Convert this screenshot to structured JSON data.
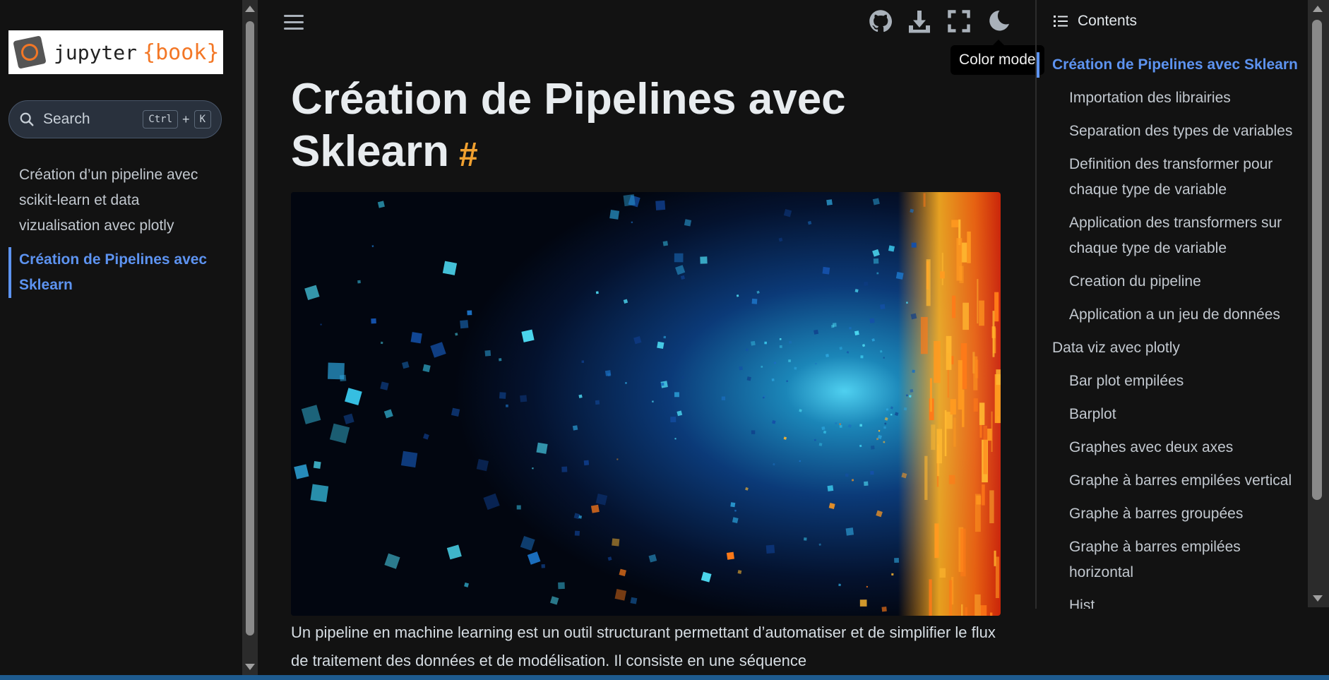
{
  "sidebar": {
    "logo": {
      "word1": "jupyter",
      "word2": "{book}"
    },
    "search": {
      "placeholder": "Search",
      "shortcut_ctrl": "Ctrl",
      "shortcut_plus": "+",
      "shortcut_key": "K"
    },
    "items": [
      {
        "label": "Création d’un pipeline avec scikit-learn et data vizualisation avec plotly",
        "active": false
      },
      {
        "label": "Création de Pipelines avec Sklearn",
        "active": true
      }
    ]
  },
  "header": {
    "icons": [
      "menu-icon",
      "github-icon",
      "download-icon",
      "fullscreen-icon",
      "moon-icon"
    ],
    "tooltip": "Color mode"
  },
  "main": {
    "title": "Création de Pipelines avec Sklearn",
    "anchor": "#",
    "paragraph": "Un pipeline en machine learning est un outil structurant permettant d’automatiser et de simplifier le flux de traitement des données et de modélisation. Il consiste en une séquence"
  },
  "toc": {
    "header": "Contents",
    "items": [
      {
        "label": "Création de Pipelines avec Sklearn",
        "level": 1,
        "active": true
      },
      {
        "label": "Importation des librairies",
        "level": 2
      },
      {
        "label": "Separation des types de variables",
        "level": 2
      },
      {
        "label": "Definition des transformer pour chaque type de variable",
        "level": 2
      },
      {
        "label": "Application des transformers sur chaque type de variable",
        "level": 2
      },
      {
        "label": "Creation du pipeline",
        "level": 2
      },
      {
        "label": "Application a un jeu de données",
        "level": 2
      },
      {
        "label": "Data viz avec plotly",
        "level": 1
      },
      {
        "label": "Bar plot empilées",
        "level": 2
      },
      {
        "label": "Barplot",
        "level": 2
      },
      {
        "label": "Graphes avec deux axes",
        "level": 2
      },
      {
        "label": "Graphe à barres empilées vertical",
        "level": 2
      },
      {
        "label": "Graphe à barres groupées",
        "level": 2
      },
      {
        "label": "Graphe à barres empilées horizontal",
        "level": 2
      },
      {
        "label": "Hist",
        "level": 2
      }
    ]
  },
  "colors": {
    "background": "#121212",
    "accent": "#5d93f0",
    "anchor": "#f0a030",
    "brand_orange": "#f37726"
  }
}
